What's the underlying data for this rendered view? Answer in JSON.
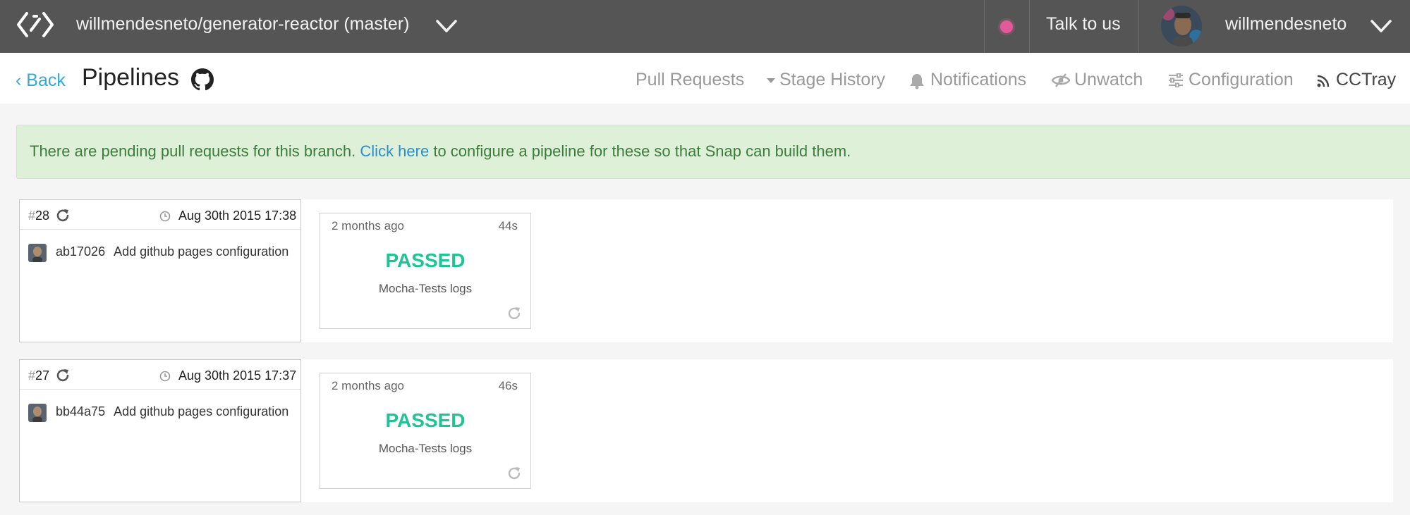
{
  "topbar": {
    "repo_label": "willmendesneto/generator-reactor (master)",
    "status_color": "#e25a9a",
    "talk_label": "Talk to us",
    "username": "willmendesneto"
  },
  "subheader": {
    "back_label": "Back",
    "title": "Pipelines",
    "nav": {
      "pull_requests": "Pull Requests",
      "stage_history": "Stage History",
      "notifications": "Notifications",
      "unwatch": "Unwatch",
      "configuration": "Configuration",
      "cctray": "CCTray"
    }
  },
  "banner": {
    "text_before": "There are pending pull requests for this branch.",
    "link_text": "Click here",
    "text_after": "to configure a pipeline for these so that Snap can build them."
  },
  "builds": [
    {
      "number": "28",
      "date": "Aug 30th 2015 17:38",
      "commit_sha": "ab17026",
      "commit_message": "Add github pages configuration",
      "stage": {
        "ago": "2 months ago",
        "duration": "44s",
        "status": "PASSED",
        "name": "Mocha-Tests logs"
      }
    },
    {
      "number": "27",
      "date": "Aug 30th 2015 17:37",
      "commit_sha": "bb44a75",
      "commit_message": "Add github pages configuration",
      "stage": {
        "ago": "2 months ago",
        "duration": "46s",
        "status": "PASSED",
        "name": "Mocha-Tests logs"
      }
    }
  ],
  "colors": {
    "topbar_bg": "#555555",
    "link_blue": "#33a9d8",
    "passed_green": "#1fc495",
    "banner_bg": "#dff0d8"
  }
}
